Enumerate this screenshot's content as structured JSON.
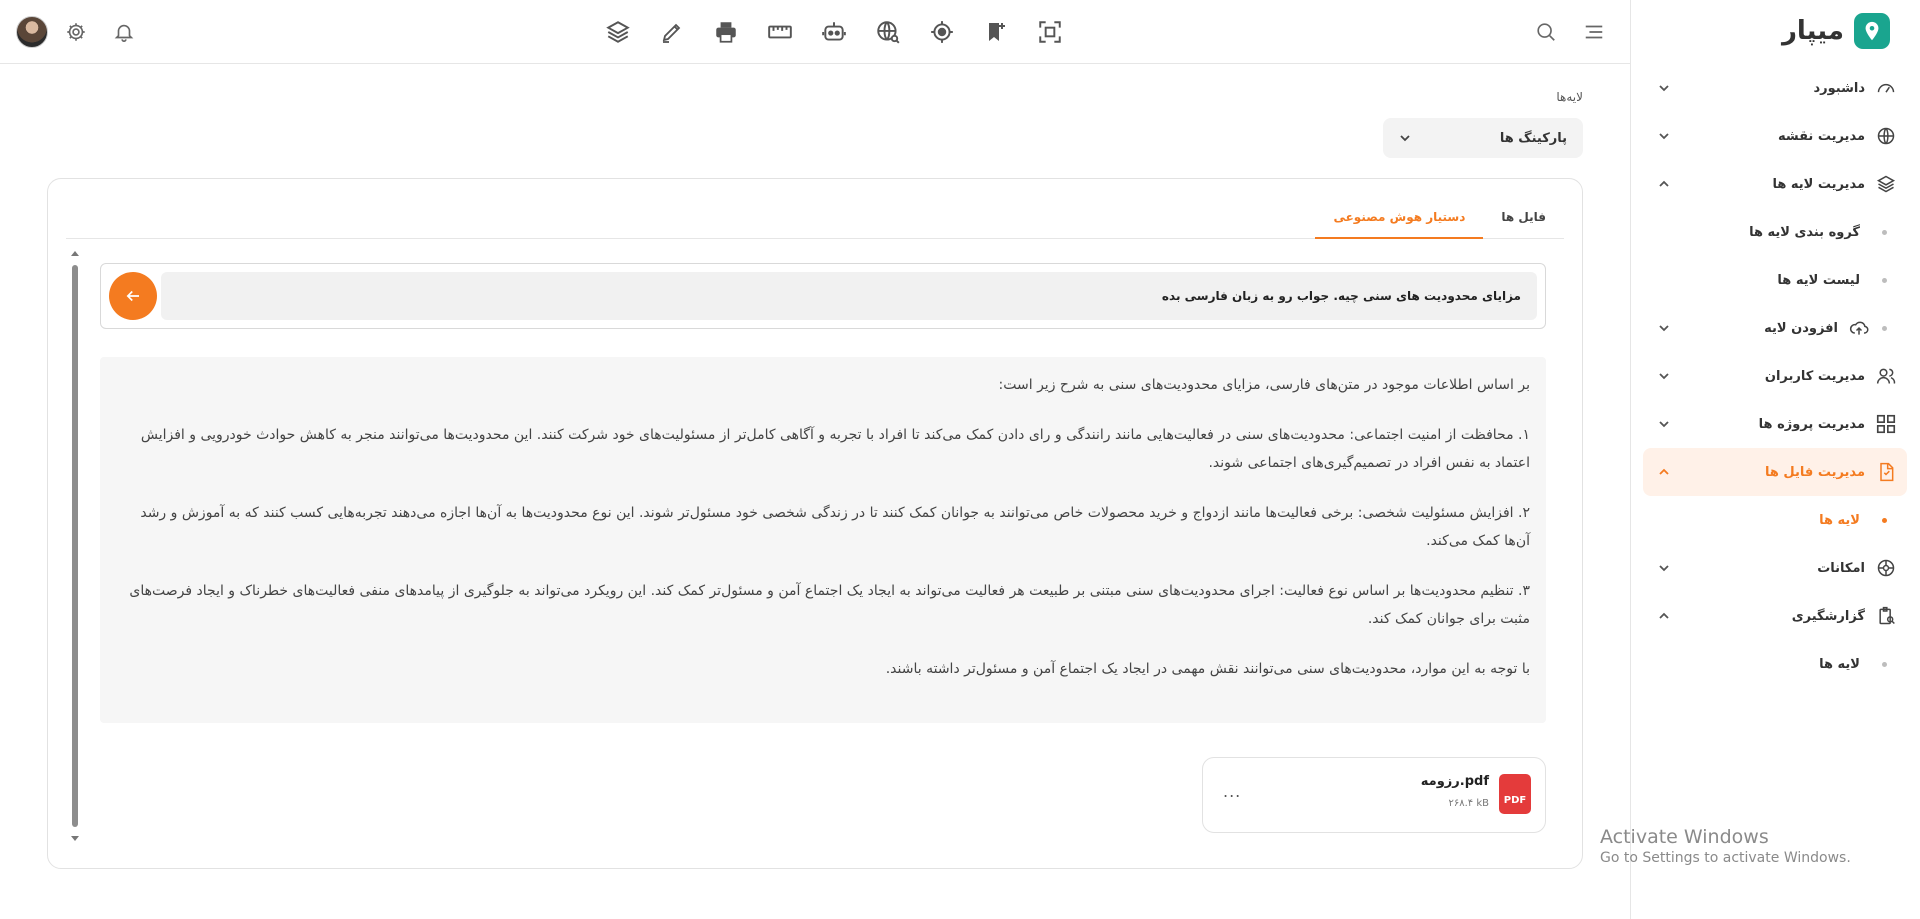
{
  "brand": {
    "name": "میپار",
    "accent": "#1aa58f"
  },
  "sidebar": {
    "items": [
      {
        "label": "داشبورد",
        "icon": "gauge-icon"
      },
      {
        "label": "مدیریت نقشه",
        "icon": "globe-icon"
      },
      {
        "label": "مدیریت لایه ها",
        "icon": "layers-icon"
      },
      {
        "label": "گروه بندی لایه ها"
      },
      {
        "label": "لیست لایه ها"
      },
      {
        "label": "افزودن لایه",
        "icon": "cloud-upload-icon"
      },
      {
        "label": "مدیریت کاربران",
        "icon": "users-icon"
      },
      {
        "label": "مدیریت پروژه ها",
        "icon": "grid-icon"
      },
      {
        "label": "مدیریت فایل ها",
        "icon": "file-icon"
      },
      {
        "label": "لایه ها"
      },
      {
        "label": "امکانات",
        "icon": "settings-wheel-icon"
      },
      {
        "label": "گزارشگیری",
        "icon": "report-icon"
      },
      {
        "label": "لایه ها"
      }
    ],
    "active_color": "#f47b20"
  },
  "main": {
    "breadcrumb": "لایه‌ها",
    "select_value": "پارکینگ ها",
    "tabs": [
      "فایل ها",
      "دستیار هوش مصنوعی"
    ],
    "query": "مزایای محدودیت های سنی چیه. جواب رو به زبان فارسی بده",
    "answer": {
      "intro": "بر اساس اطلاعات موجود در متن‌های فارسی، مزایای محدودیت‌های سنی به شرح زیر است:",
      "p1": "۱. محافظت از امنیت اجتماعی: محدودیت‌های سنی در فعالیت‌هایی مانند رانندگی و رای دادن کمک می‌کند تا افراد با تجربه و آگاهی کامل‌تر از مسئولیت‌های خود شرکت کنند. این محدودیت‌ها می‌توانند منجر به کاهش حوادث خودرویی و افزایش اعتماد به نفس افراد در تصمیم‌گیری‌های اجتماعی شوند.",
      "p2": "۲. افزایش مسئولیت شخصی: برخی فعالیت‌ها مانند ازدواج و خرید محصولات خاص می‌توانند به جوانان کمک کنند تا در زندگی شخصی خود مسئول‌تر شوند. این نوع محدودیت‌ها به آن‌ها اجازه می‌دهند تجربه‌هایی کسب کنند که به آموزش و رشد آن‌ها کمک می‌کند.",
      "p3": "۳. تنظیم محدودیت‌ها بر اساس نوع فعالیت: اجرای محدودیت‌های سنی مبتنی بر طبیعت هر فعالیت می‌تواند به ایجاد یک اجتماع آمن و مسئول‌تر کمک کند. این رویکرد می‌تواند به جلوگیری از پیامدهای منفی فعالیت‌های خطرناک و ایجاد فرصت‌های مثبت برای جوانان کمک کند.",
      "conclusion": "با توجه به این موارد، محدودیت‌های سنی می‌توانند نقش مهمی در ایجاد یک اجتماع آمن و مسئول‌تر داشته باشند."
    },
    "file": {
      "name": "رزومه.pdf",
      "size": "۲۶۸.۴ kB",
      "type_label": "PDF",
      "more": "..."
    }
  },
  "watermark": {
    "line1": "Activate Windows",
    "line2": "Go to Settings to activate Windows."
  }
}
